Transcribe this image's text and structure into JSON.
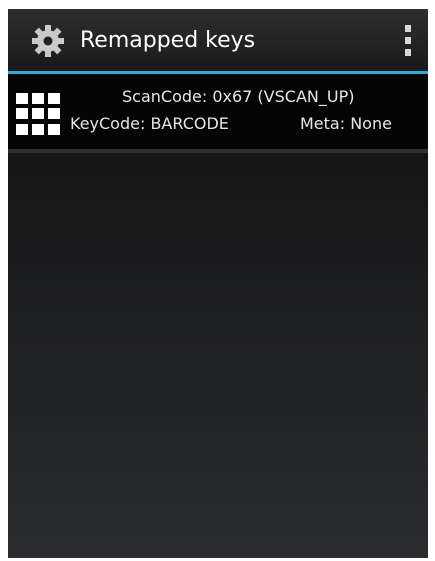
{
  "action_bar": {
    "title": "Remapped keys",
    "app_icon": "gear-icon",
    "overflow_icon": "overflow-menu-icon",
    "divider_color": "#33a8d6"
  },
  "remapped_keys": [
    {
      "icon": "keypad-icon",
      "scancode": "ScanCode: 0x67 (VSCAN_UP)",
      "keycode": "KeyCode: BARCODE",
      "meta": "Meta: None"
    }
  ]
}
